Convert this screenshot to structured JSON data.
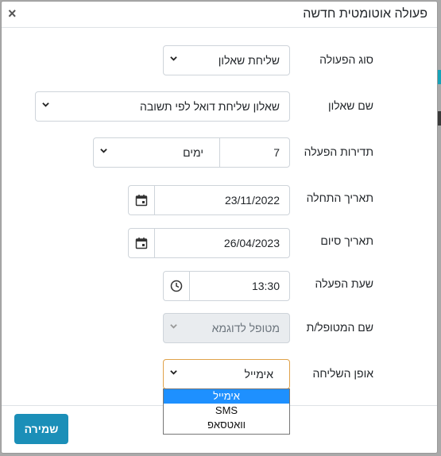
{
  "dialog": {
    "title": "פעולה אוטומטית חדשה",
    "close_label": "×"
  },
  "fields": {
    "action_type": {
      "label": "סוג הפעולה",
      "value": "שליחת שאלון"
    },
    "questionnaire": {
      "label": "שם שאלון",
      "value": "שאלון שליחת דואל לפי תשובה"
    },
    "frequency": {
      "label": "תדירות הפעלה",
      "number": "7",
      "unit": "ימים"
    },
    "start_date": {
      "label": "תאריך התחלה",
      "value": "23/11/2022"
    },
    "end_date": {
      "label": "תאריך סיום",
      "value": "26/04/2023"
    },
    "run_time": {
      "label": "שעת הפעלה",
      "value": "13:30"
    },
    "patient_name": {
      "label": "שם המטופל/ת",
      "placeholder": "מטופל לדוגמא"
    },
    "send_method": {
      "label": "אופן השליחה",
      "value": "אימייל",
      "options": [
        "אימייל",
        "SMS",
        "וואטסאפ"
      ]
    }
  },
  "footer": {
    "save_label": "שמירה"
  },
  "icons": [
    "close-icon",
    "chevron-down-icon",
    "calendar-icon",
    "clock-icon"
  ],
  "colors": {
    "save_button": "#1b8fb8",
    "selected_option": "#1e90ff",
    "focus_border": "#e0a24a"
  }
}
